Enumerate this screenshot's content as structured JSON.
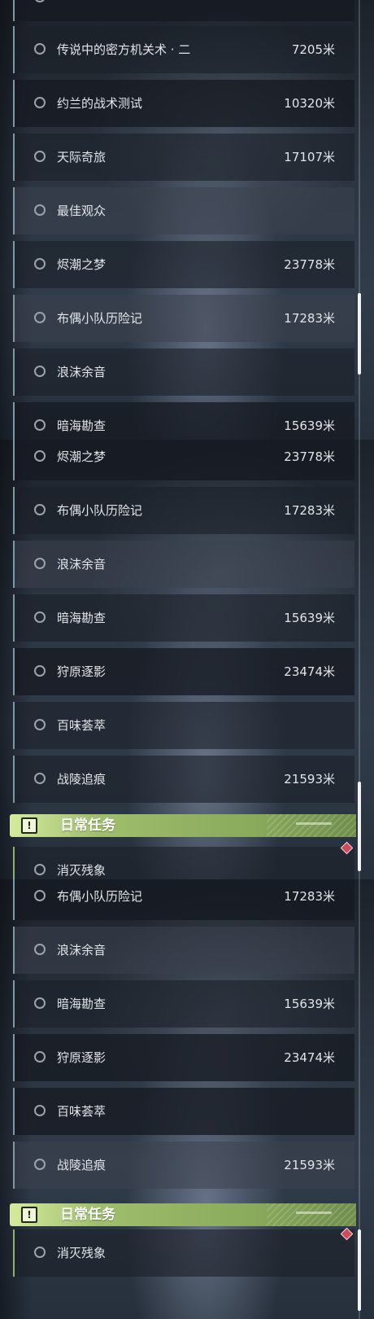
{
  "colors": {
    "row_accent": "#7e98a6",
    "daily_accent": "#8fb26b",
    "header_gradient_start": "#d6ea9e",
    "header_gradient_end": "#6f8d4b",
    "marker": "#cf4a5a",
    "text": "#e2e4e8"
  },
  "icons": {
    "radio": "radio-circle-icon",
    "header_badge": "exclamation-badge-icon",
    "marker": "red-diamond-marker-icon"
  },
  "panels": [
    {
      "scroll_fraction": 0.62,
      "rows": [
        {
          "name": "",
          "distance": ""
        },
        {
          "name": "传说中的密方机关术 · 二",
          "distance": "7205米"
        },
        {
          "name": "约兰的战术测试",
          "distance": "10320米"
        },
        {
          "name": "天际奇旅",
          "distance": "17107米"
        },
        {
          "name": "最佳观众",
          "distance": ""
        },
        {
          "name": "烬潮之梦",
          "distance": "23778米"
        },
        {
          "name": "布偶小队历险记",
          "distance": "17283米"
        },
        {
          "name": "浪沫余音",
          "distance": ""
        },
        {
          "name": "暗海勘查",
          "distance": "15639米"
        }
      ]
    },
    {
      "scroll_fraction": 0.83,
      "rows": [
        {
          "name": "烬潮之梦",
          "distance": "23778米"
        },
        {
          "name": "布偶小队历险记",
          "distance": "17283米"
        },
        {
          "name": "浪沫余音",
          "distance": ""
        },
        {
          "name": "暗海勘查",
          "distance": "15639米"
        },
        {
          "name": "狩原逐影",
          "distance": "23474米"
        },
        {
          "name": "百味荟萃",
          "distance": ""
        },
        {
          "name": "战陵追痕",
          "distance": "21593米"
        }
      ],
      "section": {
        "badge": "!",
        "title": "日常任务"
      },
      "daily_rows": [
        {
          "name": "消灭残象",
          "distance": ""
        }
      ]
    },
    {
      "scroll_fraction": 1.0,
      "rows": [
        {
          "name": "布偶小队历险记",
          "distance": "17283米"
        },
        {
          "name": "浪沫余音",
          "distance": ""
        },
        {
          "name": "暗海勘查",
          "distance": "15639米"
        },
        {
          "name": "狩原逐影",
          "distance": "23474米"
        },
        {
          "name": "百味荟萃",
          "distance": ""
        },
        {
          "name": "战陵追痕",
          "distance": "21593米"
        }
      ],
      "section": {
        "badge": "!",
        "title": "日常任务"
      },
      "daily_rows": [
        {
          "name": "消灭残象",
          "distance": ""
        }
      ]
    }
  ]
}
